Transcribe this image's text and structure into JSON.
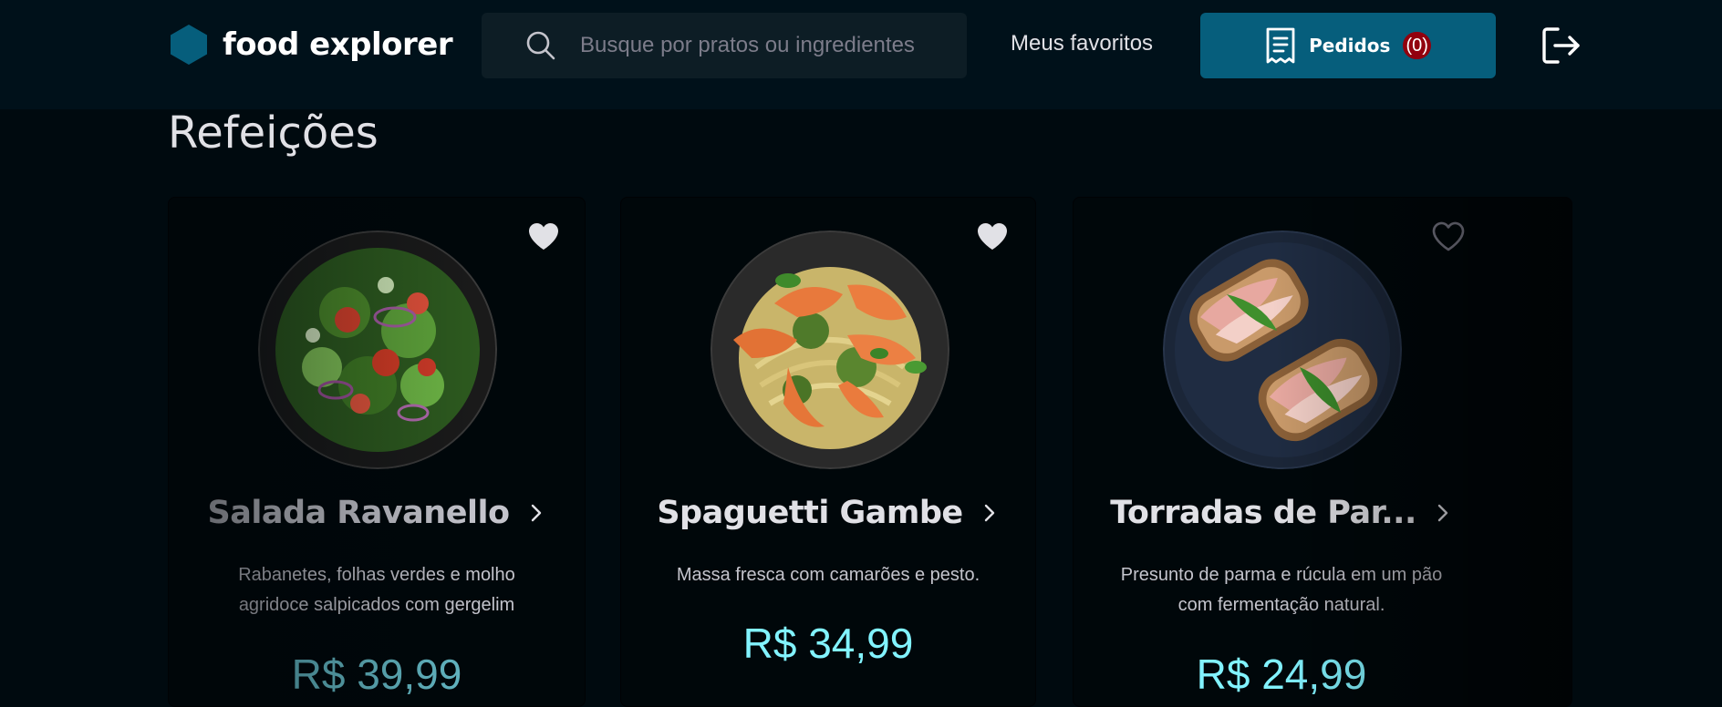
{
  "header": {
    "brand": {
      "name": "food explorer",
      "icon": "hexagon-logo-icon"
    },
    "search": {
      "placeholder": "Busque por pratos ou ingredientes",
      "icon": "search-icon"
    },
    "favorites_label": "Meus favoritos",
    "orders": {
      "label": "Pedidos",
      "count": "(0)",
      "icon": "receipt-icon"
    },
    "logout_icon": "sign-out-icon"
  },
  "section": {
    "title": "Refeições"
  },
  "dishes": [
    {
      "name": "Salada Ravanello",
      "description": "Rabanetes, folhas verdes e molho agridoce salpicados com gergelim",
      "price": "R$ 39,99",
      "favorited": true,
      "image": "salad-photo"
    },
    {
      "name": "Spaguetti Gambe",
      "description": "Massa fresca com camarões e pesto.",
      "price": "R$ 34,99",
      "favorited": true,
      "image": "shrimp-pasta-photo"
    },
    {
      "name": "Torradas de Par...",
      "description": "Presunto de parma e rúcula em um pão com fermentação natural.",
      "price": "R$ 24,99",
      "favorited": false,
      "image": "parma-toast-photo"
    }
  ],
  "colors": {
    "background": "#000a0f",
    "header": "#00111a",
    "search_bg": "#0d1d25",
    "orders_button": "#065e7c",
    "orders_badge": "#92000e",
    "price": "#82f3ff",
    "logo": "#065e7c"
  }
}
